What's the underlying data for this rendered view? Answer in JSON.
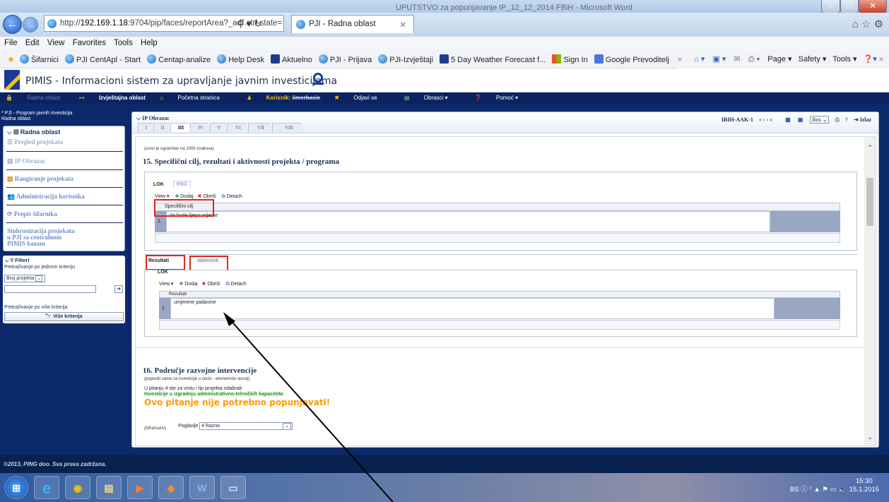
{
  "window": {
    "title": "UPUTSTVO za popunjavanje IP_12_12_2014 FBiH - Microsoft Word"
  },
  "browser": {
    "url_prefix": "http://",
    "url_host": "192.169.1.18",
    "url_rest": ":9704/pip/faces/reportArea?_adf.ctrl-state=",
    "tab_title": "PJI - Radna oblast",
    "menu": [
      "File",
      "Edit",
      "View",
      "Favorites",
      "Tools",
      "Help"
    ],
    "favorites": [
      "Šifarnici",
      "PJI CentApl - Start",
      "Centap-analize",
      "Help Desk",
      "Aktuelno",
      "PJI - Prijava",
      "PJI-Izvještaji",
      "5 Day Weather Forecast f...",
      "Sign In",
      "Google Prevoditelj"
    ],
    "tools": [
      "Page ▾",
      "Safety ▾",
      "Tools ▾"
    ]
  },
  "app": {
    "title": "PIMIS - Informacioni sistem za upravljanje javnim investicijama",
    "toolbar": {
      "radna": "Radna oblast",
      "izvjestajna": "Izvještajna oblast",
      "pocetna": "Početna stranica",
      "korisnik_label": "Korisnik:",
      "korisnik_value": "iimerbasic",
      "odjavi": "Odjavi se",
      "obrasci": "Obrasci ▾",
      "pomoc": "Pomoć ▾"
    }
  },
  "left": {
    "header": "* PJI - Program javnih investicija\nRadna oblast",
    "nav_title": "Radna oblast",
    "items": [
      "Pregled projekata",
      "IP Obrazac",
      "Rangiranje projekata",
      "Administracija korisnika",
      "Prepis šifarnika",
      "Sinhronizacija projekata\nu PJI sa centralnom\nPIMIS bazom"
    ],
    "filter_title": "Filteri",
    "single_label": "Pretraživanje po jednom kriteriju",
    "single_select": "Broj projekta",
    "multi_label": "Pretraživanje po više kriterija",
    "multi_button": "Više kriterija"
  },
  "main": {
    "title": "IP Obrazac",
    "tabs": [
      "I",
      "II",
      "III",
      "IV",
      "V",
      "VI",
      "VII",
      "VIII"
    ],
    "active_tab": "III",
    "code": "IBIH-AAK-1",
    "pager_select": "Bos",
    "exit": "Izlaz",
    "note": "(unos je ograničen na 1000 znakova)",
    "sec15": "15. Specifični cilj, rezultati i aktivnosti projekta / programa",
    "lang_tabs": [
      "LOK",
      "ENG"
    ],
    "toolbar": {
      "view": "View ▾",
      "add": "Dodaj",
      "delete": "Obriši",
      "detach": "Detach"
    },
    "grid1": {
      "header": "Specifični cilj",
      "row_no": "1",
      "value": "da bude lijepo vrijeme"
    },
    "sub_tabs": [
      "Rezultati",
      "Aktivnosti"
    ],
    "lok": "LOK",
    "grid2": {
      "header": "Rezultati",
      "row_no": "1",
      "value": "umjerene padavine"
    },
    "sec16": "16. Područje razvojne intervencije",
    "sec16_note": "(popuniti samo za investicije u socio - ekonomski razvoj)",
    "q_label": "U pitanju 4 ste za vrstu i tip projekta odabrali:",
    "q_green": "Investicije u izgradnju administrativno-tehničkih kapaciteta",
    "q_orange": "Ovo pitanje nije potrebno popunjavati!",
    "sifra_label": "(šifra/naziv)",
    "poglavlje_label": "Poglavlje",
    "poglavlje_value": "4 Razno"
  },
  "footer": {
    "copyright": "©2013, PING doo. Sva prava zadržana."
  },
  "taskbar": {
    "lang": "BS",
    "time": "15:30",
    "date": "15.1.2015"
  },
  "colors": {
    "navy": "#0c2a6b",
    "red_box": "#e2231a",
    "green": "#1a8a1a",
    "orange": "#ff9900"
  }
}
